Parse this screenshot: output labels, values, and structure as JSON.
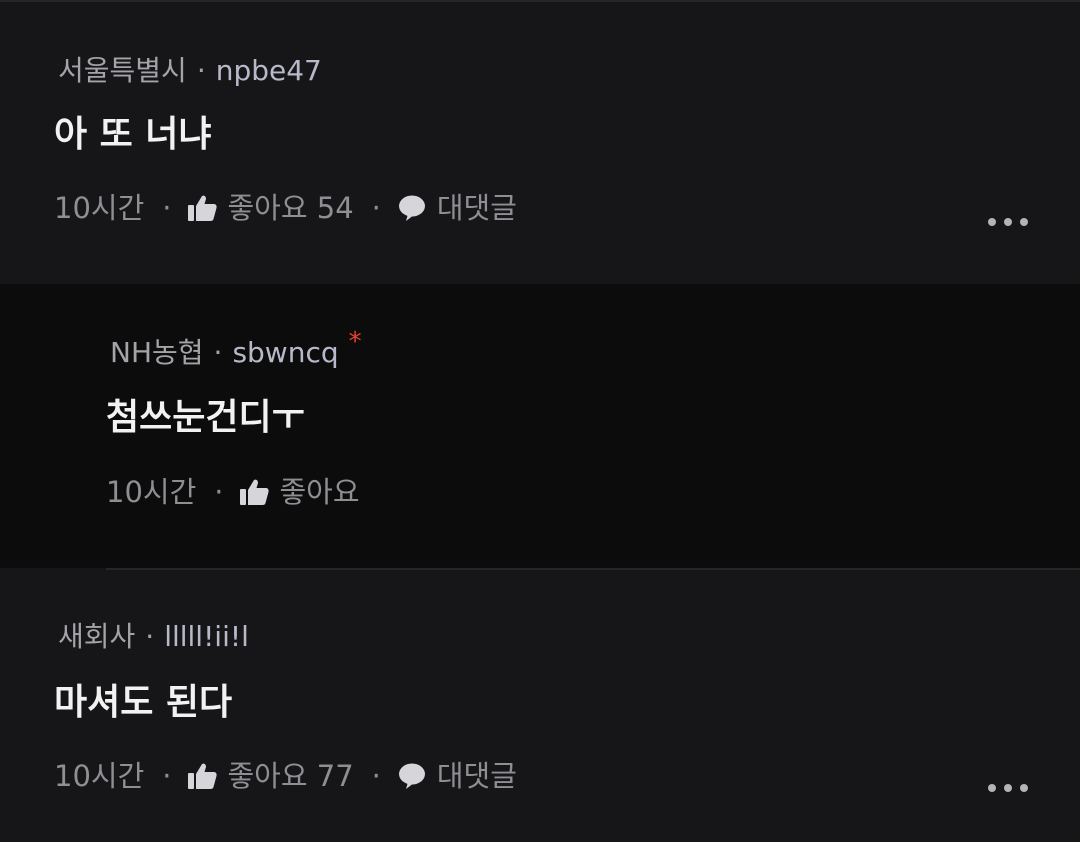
{
  "comments": [
    {
      "location": "서울특별시",
      "username": "npbe47",
      "text": "아 또 너냐",
      "time": "10시간",
      "like_label": "좋아요",
      "like_count": "54",
      "reply_label": "대댓글"
    },
    {
      "location": "NH농협",
      "username": "sbwncq",
      "badge": "*",
      "text": "첨쓰눈건디ㅜ",
      "time": "10시간",
      "like_label": "좋아요"
    },
    {
      "location": "새회사",
      "username": "lllll!ii!l",
      "text": "마셔도 된다",
      "time": "10시간",
      "like_label": "좋아요",
      "like_count": "77",
      "reply_label": "대댓글"
    }
  ],
  "separator": "·",
  "icons": {
    "like": "thumbs-up-icon",
    "reply": "speech-bubble-icon",
    "more": "more-options-icon"
  },
  "colors": {
    "background": "#161618",
    "reply_background": "#0c0c0d",
    "badge": "#e8412f"
  }
}
